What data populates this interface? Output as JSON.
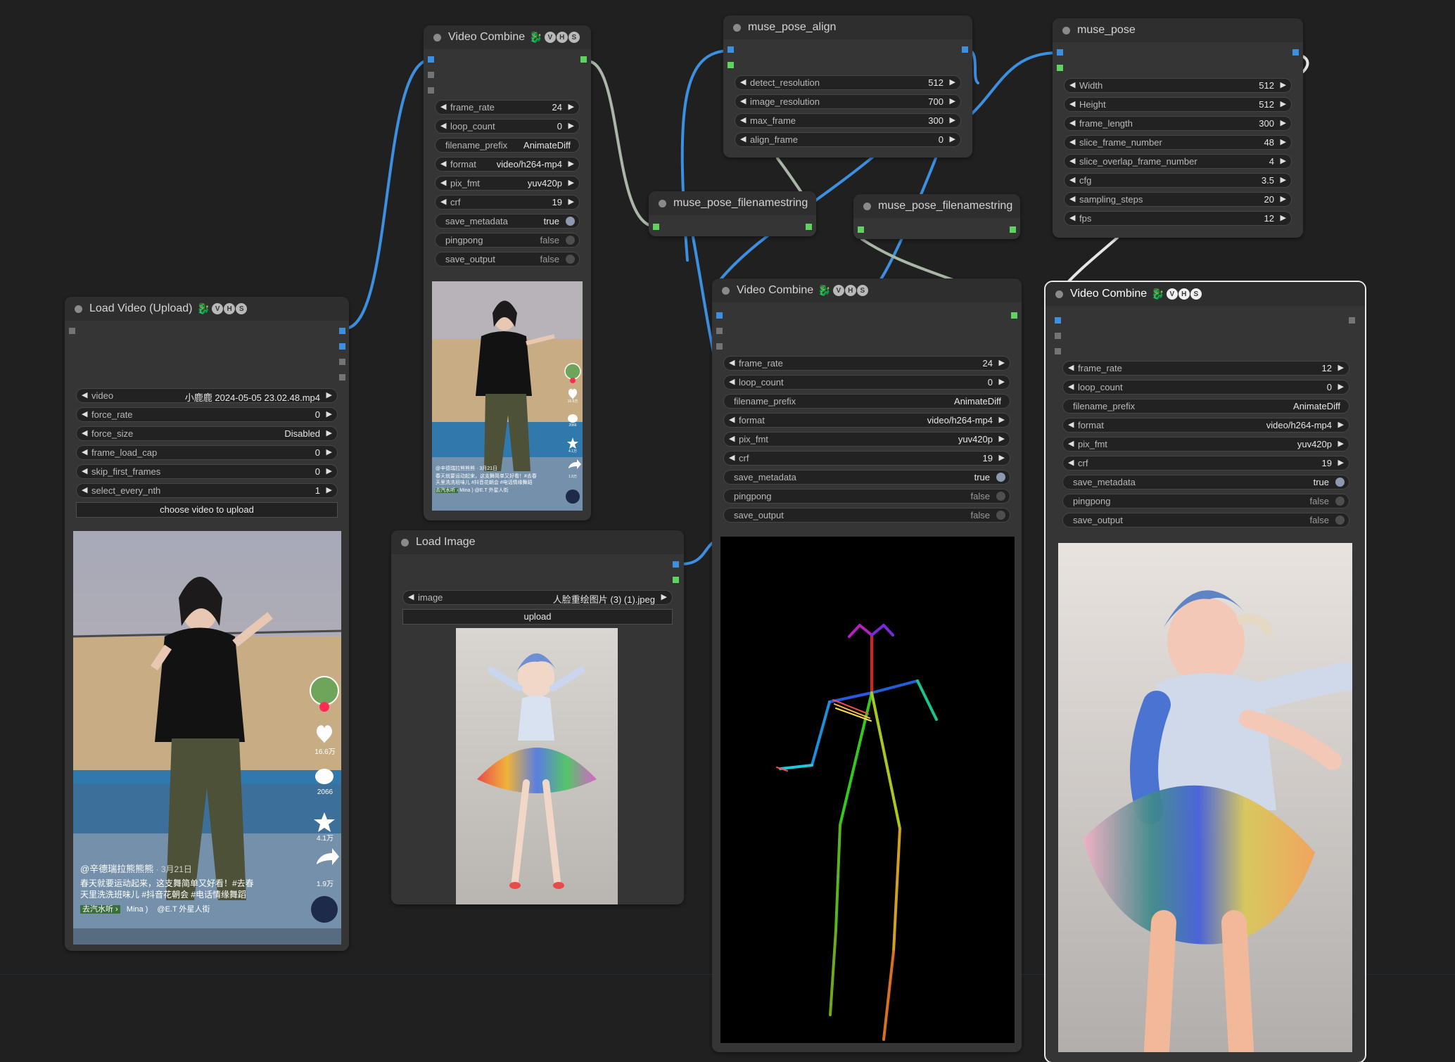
{
  "nodes": {
    "load_video": {
      "title": "Load Video (Upload)",
      "title_icon": "dragon-emoji",
      "badges": [
        "V",
        "H",
        "S"
      ],
      "widgets": [
        {
          "label": "video",
          "value": "小鹿鹿 2024-05-05 23.02.48.mp4"
        },
        {
          "label": "force_rate",
          "value": "0"
        },
        {
          "label": "force_size",
          "value": "Disabled"
        },
        {
          "label": "frame_load_cap",
          "value": "0"
        },
        {
          "label": "skip_first_frames",
          "value": "0"
        },
        {
          "label": "select_every_nth",
          "value": "1"
        }
      ],
      "upload_button": "choose video to upload",
      "preview": {
        "caption_user": "@辛德瑞拉熊熊熊",
        "caption_date": "· 3月21日",
        "caption_line1": "春天就要运动起来，这支舞简单又好看！#去春",
        "caption_line2": "天里洗洗班味儿 #抖音花朝会 #电话情缘舞蹈",
        "music_tag": "去汽水听 ›",
        "music_name": "Mina )",
        "music_author": "@E.T 外星人街",
        "likes": "16.6万",
        "comments": "2066",
        "stars": "4.1万",
        "shares": "1.9万"
      }
    },
    "vc1": {
      "title": "Video Combine",
      "title_icon": "dragon-emoji",
      "badges": [
        "V",
        "H",
        "S"
      ],
      "widgets": [
        {
          "label": "frame_rate",
          "value": "24"
        },
        {
          "label": "loop_count",
          "value": "0"
        },
        {
          "label": "filename_prefix",
          "value": "AnimateDiff"
        },
        {
          "label": "format",
          "value": "video/h264-mp4"
        },
        {
          "label": "pix_fmt",
          "value": "yuv420p"
        },
        {
          "label": "crf",
          "value": "19"
        },
        {
          "label": "save_metadata",
          "value": "true"
        },
        {
          "label": "pingpong",
          "value": "false"
        },
        {
          "label": "save_output",
          "value": "false"
        }
      ],
      "preview": {
        "caption_user": "@辛德瑞拉熊熊熊",
        "caption_date": "· 3月21日",
        "caption_line1": "春天就要运动起来，这支舞简单又好看！#去春",
        "caption_line2": "天里洗洗班味儿 #抖音花朝会 #电话情缘舞蹈",
        "music_tag": "去汽水听 ›",
        "music_name": "Mina )",
        "music_author": "@E.T 外星人街",
        "likes": "16.6万",
        "comments": "2066",
        "stars": "4.1万",
        "shares": "1.9万"
      }
    },
    "align": {
      "title": "muse_pose_align",
      "widgets": [
        {
          "label": "detect_resolution",
          "value": "512"
        },
        {
          "label": "image_resolution",
          "value": "700"
        },
        {
          "label": "max_frame",
          "value": "300"
        },
        {
          "label": "align_frame",
          "value": "0"
        }
      ]
    },
    "fns1": {
      "title": "muse_pose_filenamestring"
    },
    "fns2": {
      "title": "muse_pose_filenamestring"
    },
    "musepose": {
      "title": "muse_pose",
      "widgets": [
        {
          "label": "Width",
          "value": "512"
        },
        {
          "label": "Height",
          "value": "512"
        },
        {
          "label": "frame_length",
          "value": "300"
        },
        {
          "label": "slice_frame_number",
          "value": "48"
        },
        {
          "label": "slice_overlap_frame_number",
          "value": "4"
        },
        {
          "label": "cfg",
          "value": "3.5"
        },
        {
          "label": "sampling_steps",
          "value": "20"
        },
        {
          "label": "fps",
          "value": "12"
        }
      ]
    },
    "load_image": {
      "title": "Load Image",
      "widgets": [
        {
          "label": "image",
          "value": "人脸重绘图片 (3) (1).jpeg"
        }
      ],
      "upload_button": "upload"
    },
    "vc2": {
      "title": "Video Combine",
      "title_icon": "dragon-emoji",
      "badges": [
        "V",
        "H",
        "S"
      ],
      "widgets": [
        {
          "label": "frame_rate",
          "value": "24"
        },
        {
          "label": "loop_count",
          "value": "0"
        },
        {
          "label": "filename_prefix",
          "value": "AnimateDiff"
        },
        {
          "label": "format",
          "value": "video/h264-mp4"
        },
        {
          "label": "pix_fmt",
          "value": "yuv420p"
        },
        {
          "label": "crf",
          "value": "19"
        },
        {
          "label": "save_metadata",
          "value": "true"
        },
        {
          "label": "pingpong",
          "value": "false"
        },
        {
          "label": "save_output",
          "value": "false"
        }
      ]
    },
    "vc3": {
      "title": "Video Combine",
      "title_icon": "dragon-emoji",
      "badges": [
        "V",
        "H",
        "S"
      ],
      "widgets": [
        {
          "label": "frame_rate",
          "value": "12"
        },
        {
          "label": "loop_count",
          "value": "0"
        },
        {
          "label": "filename_prefix",
          "value": "AnimateDiff"
        },
        {
          "label": "format",
          "value": "video/h264-mp4"
        },
        {
          "label": "pix_fmt",
          "value": "yuv420p"
        },
        {
          "label": "crf",
          "value": "19"
        },
        {
          "label": "save_metadata",
          "value": "true"
        },
        {
          "label": "pingpong",
          "value": "false"
        },
        {
          "label": "save_output",
          "value": "false"
        }
      ]
    }
  },
  "colors": {
    "canvas": "#202020",
    "node_body": "#353535",
    "node_title": "#2e2e2e",
    "image_link": "#3d8fe0",
    "string_link": "#a9b8a6",
    "slot_blue": "#3d8fe0",
    "slot_green": "#5fd35f"
  }
}
